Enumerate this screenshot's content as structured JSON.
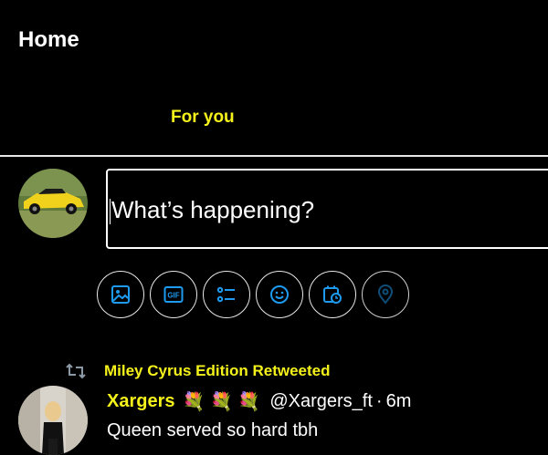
{
  "colors": {
    "accent": "#f4f21a",
    "icon_blue": "#1d9bf0",
    "background": "#000000",
    "text": "#ffffff",
    "divider": "#e8e8e8"
  },
  "header": {
    "title": "Home",
    "tabs": [
      {
        "label": "For you",
        "selected": true
      }
    ]
  },
  "composer": {
    "placeholder": "What’s happening?",
    "avatar_icon": "profile-photo-yellow-car",
    "toolbar": [
      {
        "name": "media",
        "icon": "image-icon"
      },
      {
        "name": "gif",
        "icon": "gif-icon",
        "text": "GIF"
      },
      {
        "name": "poll",
        "icon": "poll-icon"
      },
      {
        "name": "emoji",
        "icon": "emoji-icon"
      },
      {
        "name": "schedule",
        "icon": "schedule-icon"
      },
      {
        "name": "location",
        "icon": "location-icon",
        "disabled": true
      }
    ]
  },
  "tweet": {
    "retweet_icon": "retweet-icon",
    "retweeted_by": "Miley Cyrus Edition Retweeted",
    "author_name": "Xargers",
    "author_emoji": "💐 💐 💐",
    "handle": "@Xargers_ft",
    "separator": "·",
    "time": "6m",
    "text": "Queen served so hard tbh"
  }
}
